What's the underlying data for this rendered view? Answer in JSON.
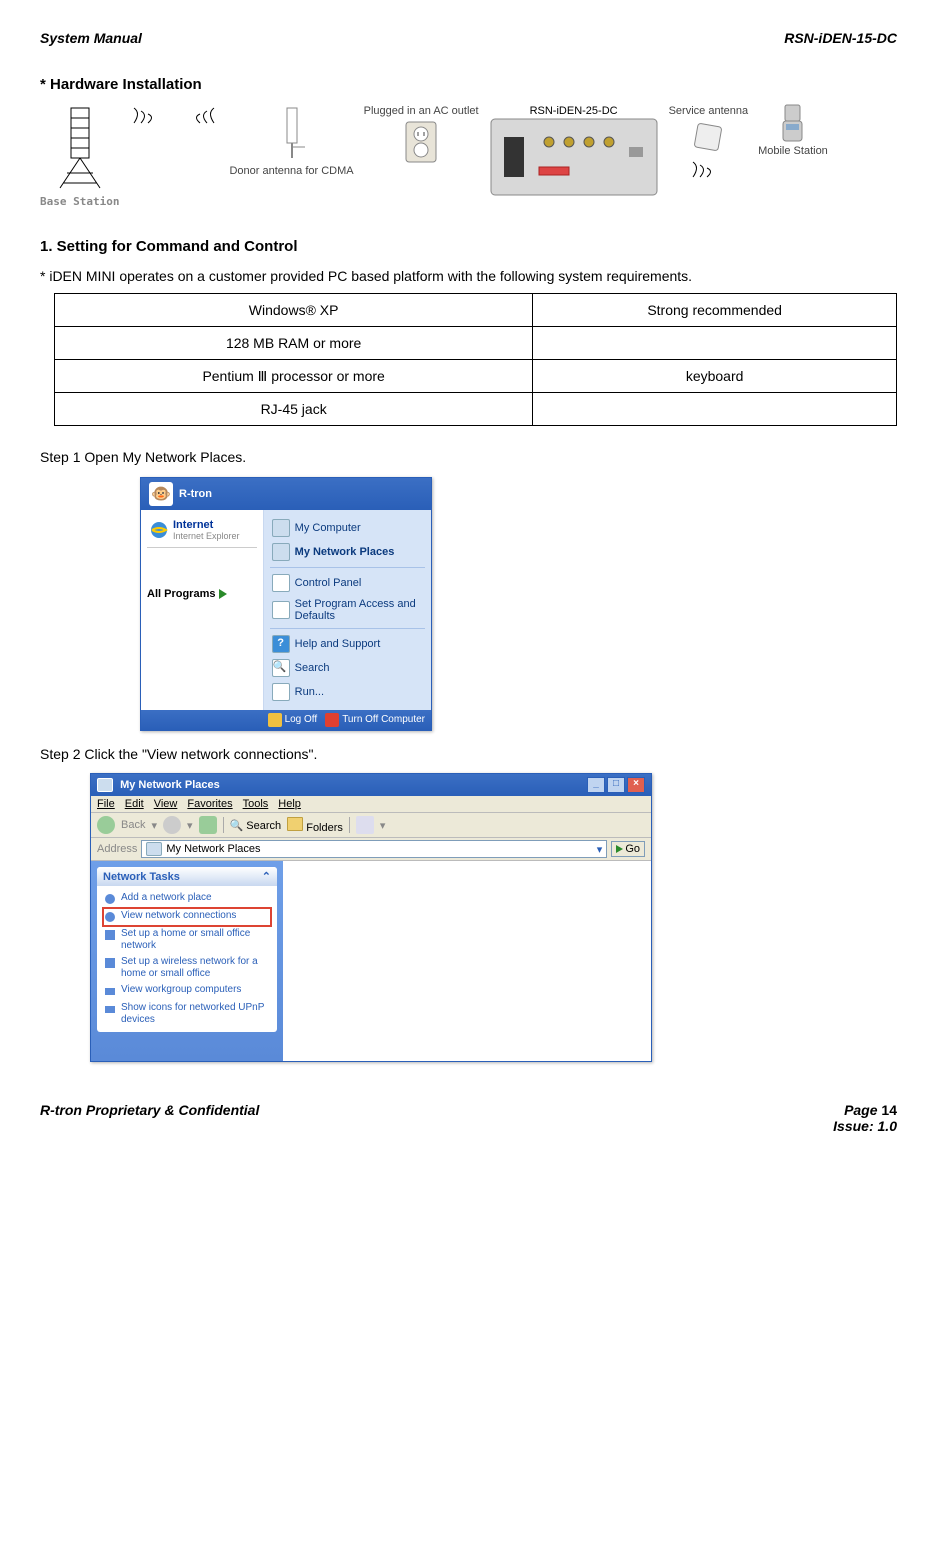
{
  "header": {
    "left": "System Manual",
    "right": "RSN-iDEN-15-DC"
  },
  "section_hw": "* Hardware Installation",
  "diagram": {
    "base_station": "Base Station",
    "donor_antenna": "Donor antenna for CDMA",
    "plugged": "Plugged in an AC outlet",
    "repeater": "RSN-iDEN-25-DC",
    "service_antenna": "Service antenna",
    "mobile_station": "Mobile Station"
  },
  "section_setting": "1. Setting for Command and Control",
  "body_setting_1": "* iDEN MINI operates on a customer provided PC based platform with the following system requirements.",
  "req_table": {
    "rows": [
      [
        "Windows® XP",
        "Strong recommended"
      ],
      [
        "128 MB RAM or more",
        ""
      ],
      [
        "Pentium Ⅲ processor or more",
        "keyboard"
      ],
      [
        "RJ-45 jack",
        ""
      ]
    ]
  },
  "step1": "Step 1 Open My Network Places.",
  "startmenu": {
    "user": "R-tron",
    "left_items": {
      "ie": "Internet",
      "ie_sub": "Internet Explorer",
      "all_programs": "All Programs"
    },
    "right_items": [
      "My Computer",
      "My Network Places",
      "Control Panel",
      "Set Program Access and Defaults",
      "Help and Support",
      "Search",
      "Run..."
    ],
    "bottom": {
      "logoff": "Log Off",
      "turnoff": "Turn Off Computer"
    }
  },
  "step2": "Step 2 Click the \"View network connections\".",
  "window": {
    "title": "My Network Places",
    "menu": [
      "File",
      "Edit",
      "View",
      "Favorites",
      "Tools",
      "Help"
    ],
    "toolbar": {
      "back": "Back",
      "search": "Search",
      "folders": "Folders"
    },
    "address_label": "Address",
    "address_value": "My Network Places",
    "go": "Go",
    "task_head": "Network Tasks",
    "tasks": [
      "Add a network place",
      "View network connections",
      "Set up a home or small office network",
      "Set up a wireless network for a home or small office",
      "View workgroup computers",
      "Show icons for networked UPnP devices"
    ]
  },
  "footer": {
    "left": "R-tron Proprietary & Confidential",
    "page": "Page 14",
    "issue": "Issue: 1.0"
  }
}
